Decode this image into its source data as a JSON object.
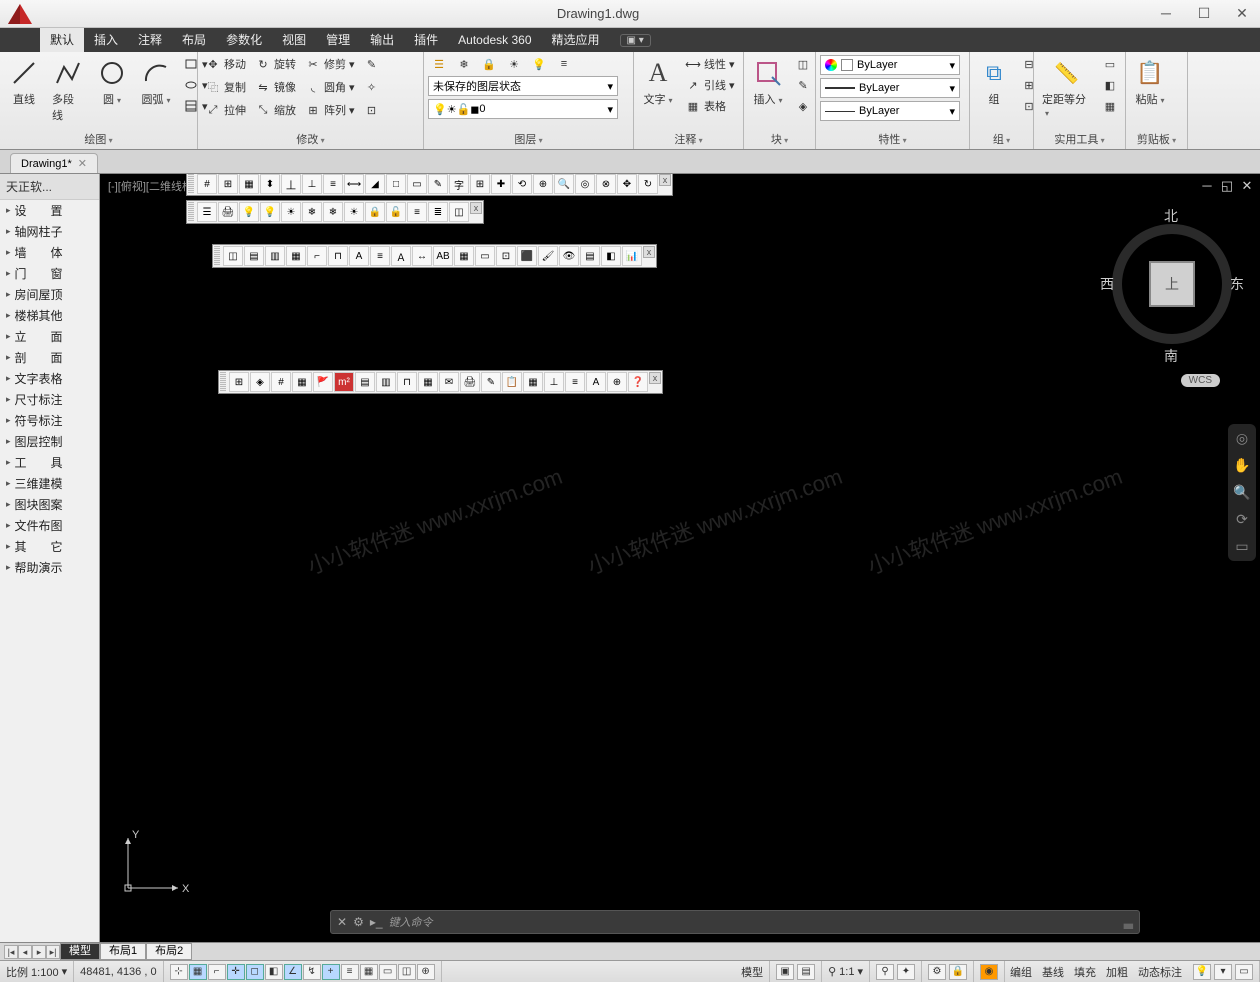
{
  "title": "Drawing1.dwg",
  "menubar": [
    "默认",
    "插入",
    "注释",
    "布局",
    "参数化",
    "视图",
    "管理",
    "输出",
    "插件",
    "Autodesk 360",
    "精选应用"
  ],
  "ribbon": {
    "draw": {
      "title": "绘图",
      "line": "直线",
      "pline": "多段线",
      "circle": "圆",
      "arc": "圆弧"
    },
    "modify": {
      "title": "修改",
      "move": "移动",
      "rotate": "旋转",
      "trim": "修剪",
      "copy": "复制",
      "mirror": "镜像",
      "fillet": "圆角",
      "stretch": "拉伸",
      "scale": "缩放",
      "array": "阵列"
    },
    "layer": {
      "title": "图层",
      "state": "未保存的图层状态",
      "current": "0"
    },
    "annot": {
      "title": "注释",
      "text": "文字",
      "linear": "线性",
      "leader": "引线",
      "table": "表格"
    },
    "block": {
      "title": "块",
      "insert": "插入"
    },
    "prop": {
      "title": "特性",
      "bylayer": "ByLayer"
    },
    "group": {
      "title": "组",
      "btn": "组"
    },
    "util": {
      "title": "实用工具",
      "measure": "定距等分"
    },
    "clip": {
      "title": "剪贴板",
      "paste": "粘贴"
    }
  },
  "filetab": "Drawing1*",
  "sidebar": {
    "title": "天正软...",
    "items": [
      "设　　置",
      "轴网柱子",
      "墙　　体",
      "门　　窗",
      "房间屋顶",
      "楼梯其他",
      "立　　面",
      "剖　　面",
      "文字表格",
      "尺寸标注",
      "符号标注",
      "图层控制",
      "工　　具",
      "三维建模",
      "图块图案",
      "文件布图",
      "其　　它",
      "帮助演示"
    ]
  },
  "canvas_label": "[-][俯视][二维线框]",
  "viewcube": {
    "n": "北",
    "s": "南",
    "e": "东",
    "w": "西",
    "top": "上"
  },
  "wcs": "WCS",
  "watermark": "小小软件迷 www.xxrjm.com",
  "cmd_prompt": "键入命令",
  "model_tabs": [
    "模型",
    "布局1",
    "布局2"
  ],
  "status": {
    "scale": "比例 1:100",
    "coords": "48481, 4136 , 0",
    "model": "模型",
    "annoscale": "1:1",
    "right": [
      "编组",
      "基线",
      "填充",
      "加粗",
      "动态标注"
    ]
  }
}
